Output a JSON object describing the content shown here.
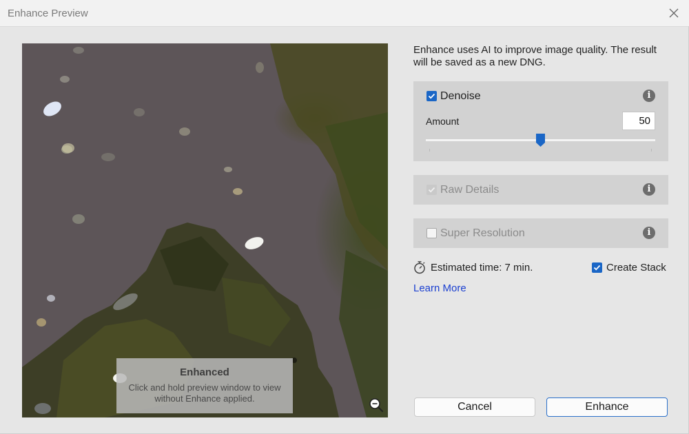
{
  "window": {
    "title": "Enhance Preview",
    "close_icon": "close-icon"
  },
  "preview": {
    "overlay_title": "Enhanced",
    "overlay_text": "Click and hold preview window to view without Enhance applied.",
    "zoom_icon": "zoom-out-icon"
  },
  "description": "Enhance uses AI to improve image quality. The result will be saved as a new DNG.",
  "options": {
    "denoise": {
      "label": "Denoise",
      "checked": true,
      "amount_label": "Amount",
      "amount_value": "50",
      "slider_fraction": 0.5
    },
    "raw_details": {
      "label": "Raw Details",
      "checked": true,
      "disabled": true
    },
    "super_resolution": {
      "label": "Super Resolution",
      "checked": false
    }
  },
  "estimate": {
    "text": "Estimated time: 7 min."
  },
  "create_stack": {
    "label": "Create Stack",
    "checked": true
  },
  "learn_more": "Learn More",
  "buttons": {
    "cancel": "Cancel",
    "enhance": "Enhance"
  },
  "colors": {
    "accent": "#1a66c6",
    "link": "#1a3fd0",
    "panel": "#d2d2d2",
    "background": "#e6e6e6"
  }
}
